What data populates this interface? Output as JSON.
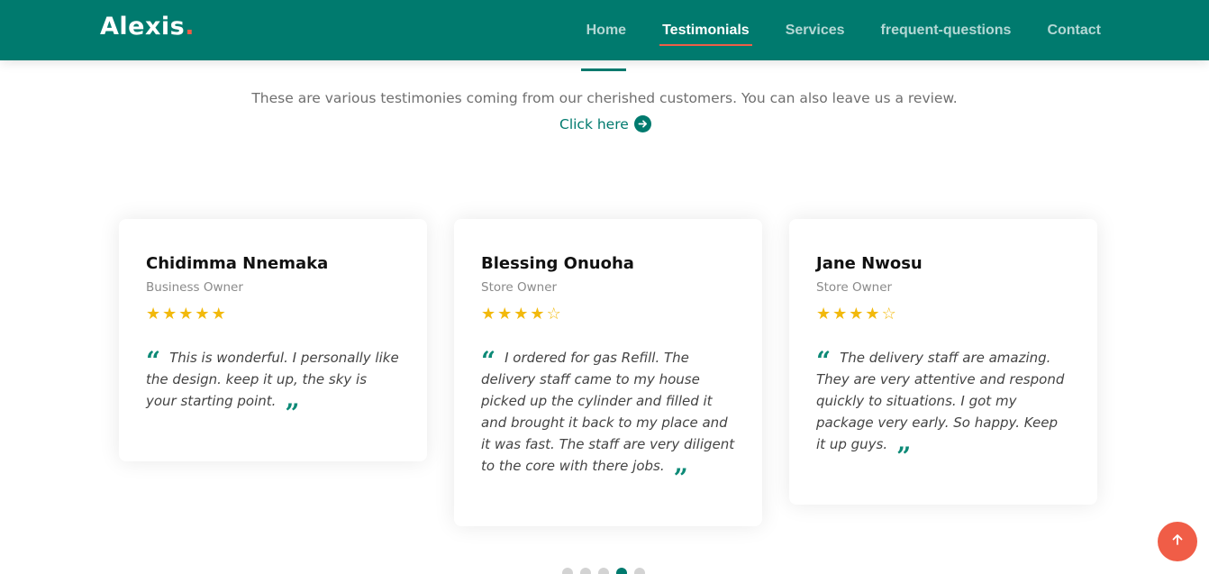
{
  "brand": {
    "name": "Alexis",
    "dot": ".",
    "accent_color": "#f05d47",
    "primary_color": "#007a6e"
  },
  "nav": {
    "items": [
      {
        "label": "Home",
        "active": false
      },
      {
        "label": "Testimonials",
        "active": true
      },
      {
        "label": "Services",
        "active": false
      },
      {
        "label": "frequent-questions",
        "active": false
      },
      {
        "label": "Contact",
        "active": false
      }
    ]
  },
  "intro": {
    "text": "These are various testimonies coming from our cherished customers. You can also leave us a review.",
    "link_label": "Click here",
    "link_icon": "arrow-right-circle-icon"
  },
  "testimonials": [
    {
      "name": "Chidimma Nnemaka",
      "role": "Business Owner",
      "rating": 5,
      "max_rating": 5,
      "quote": "This is wonderful. I personally like the design. keep it up, the sky is your starting point."
    },
    {
      "name": "Blessing Onuoha",
      "role": "Store Owner",
      "rating": 4,
      "max_rating": 5,
      "quote": "I ordered for gas Refill. The delivery staff came to my house picked up the cylinder and filled it and brought it back to my place and it was fast. The staff are very diligent to the core with there jobs."
    },
    {
      "name": "Jane Nwosu",
      "role": "Store Owner",
      "rating": 4,
      "max_rating": 5,
      "quote": "The delivery staff are amazing. They are very attentive and respond quickly to situations. I got my package very early. So happy. Keep it up guys."
    }
  ],
  "carousel": {
    "total_slides": 5,
    "active_index": 3
  },
  "back_to_top": {
    "icon": "arrow-up-icon"
  }
}
